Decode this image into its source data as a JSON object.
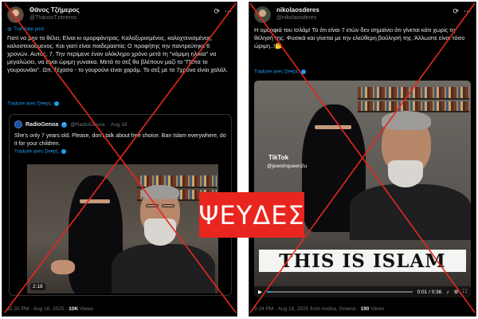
{
  "left_post": {
    "author": "Θάνος Τζήμερος",
    "handle": "@ThanosTzimeros",
    "translate_label": "Translate post",
    "body": "Γιατί να μην το θέλει; Είναι κι ομορφάντρας. Καλοξυρισμένος, καλοχτενισμένος, καλοστεκούμενος. Και γιατί είναι παιδεραστία; Ο προφήτης την παντρεύτηκε 6 χρονών. Αυτός, 7. Την περίμενε έναν ολόκληρο χρόνο μετά τη \"νόμιμη ηλικία\" να μεγαλώσει, να είναι ώριμη γυναίκα. Μετά το σεξ θα βλέπουν μαζί το \"Πέπα το γουρουνάκι\". Ωπ, ξέχασα - το γουρούνι είναι χαράμ. Το σεξ με το 7χρονο είναι χαλάλ.",
    "translate_by": "Traduire avec DeepL",
    "quote": {
      "name": "RadioGenoa",
      "handle": "@RadioGenoa",
      "date": "· Aug 16",
      "text": "She's only 7 years old. Please, don't talk about free choice. Ban Islam everywhere, do it for your children.",
      "translate_by": "Traduire avec DeepL",
      "video_time": "2:18"
    },
    "footer_time": "11:32 PM · Aug 16, 2025 · ",
    "views_count": "10K",
    "views_label": " Views"
  },
  "right_post": {
    "author": "nikolaosderes",
    "handle": "@nikolaosderes",
    "body": "Η ομορφιά του Ισλάμ! Το ότι είναι 7 ετών δεν σημαίνει ότι γίνεται κάτι χωρίς τη θέλησή της. Φυσικά και γίνεται με την ελεύθερη βούλησή της. Άλλωστε είναι τόσο ώριμη..!🤔",
    "translate_by": "Traduire avec DeepL",
    "tiktok_label": "TikTok",
    "tiktok_handle": "@jewishqueen2u",
    "banner": "THIS IS ISLAM",
    "video_time": "0:01 / 0:36",
    "video_progress": 0.03,
    "footer_time": "9:24 PM · Aug 18, 2025 from Avdira, Greece · ",
    "views_count": "190",
    "views_label": " Views"
  },
  "stamp": "ΨΕΥΔΕΣ",
  "colors": {
    "accent": "#1d9bf0",
    "stamp": "#e8261f",
    "cross": "#e8261f"
  }
}
